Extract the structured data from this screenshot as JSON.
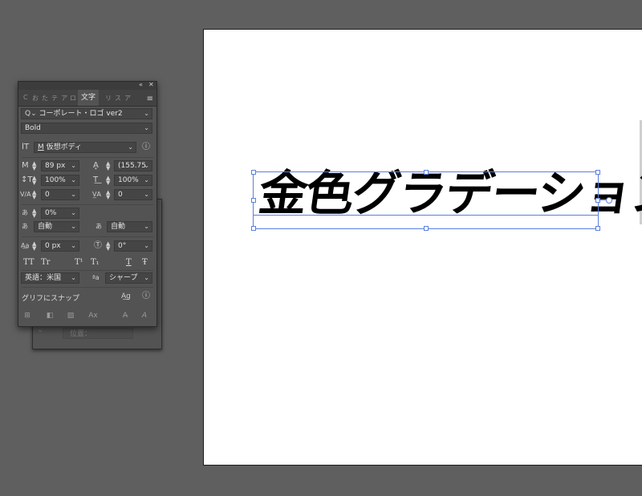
{
  "canvas": {
    "text": "金色グラデーション"
  },
  "back_panel": {
    "position_label": "位置："
  },
  "panel": {
    "tabs": [
      "C",
      "お",
      "た",
      "テ",
      "ア",
      "ロ",
      "文字",
      "リ",
      "ス",
      "ア"
    ],
    "active_tab": "文字",
    "font_family": "コーポレート・ロゴ ver2",
    "font_style": "Bold",
    "font_name_selector": "仮想ボディ",
    "font_size": "89 px",
    "leading": "(155.75",
    "vertical_scale": "100%",
    "horizontal_scale": "100%",
    "kerning": "0",
    "tracking": "0",
    "tsume": "0%",
    "aki_left": "自動",
    "aki_right": "自動",
    "baseline_shift": "0 px",
    "rotation": "0°",
    "style_buttons": [
      "TT",
      "Tr",
      "T¹",
      "T₁",
      "T",
      "Ŧ"
    ],
    "language": "英語：米国",
    "antialias": "シャープ",
    "snap_label": "グリフにスナップ",
    "ui_glyphs": {
      "collapse": "«",
      "close": "✕",
      "menu": "≡",
      "dropdown": "⌄",
      "spin_up": "▲",
      "spin_down": "▼",
      "info": "ⓘ",
      "font_size_icon": "ⵏT",
      "indicator": "M",
      "search": "Q⌄",
      "size": "M",
      "leading": "A͓",
      "vscale": "↕T",
      "hscale": "T͟",
      "kerning": "V/A",
      "tracking": "V̲A",
      "tsume": "あ",
      "aki_left": "あ",
      "aki_right": "あ",
      "baseline": "A͟a",
      "rotation": "Ⓣ",
      "antialias": "ªa",
      "snap_icon": "A͟g",
      "btn_align1": "⊞",
      "btn_align2": "◧",
      "btn_image": "▨",
      "btn_ax": "Ax",
      "btn_a1": "A̶",
      "btn_a2": "A"
    }
  }
}
